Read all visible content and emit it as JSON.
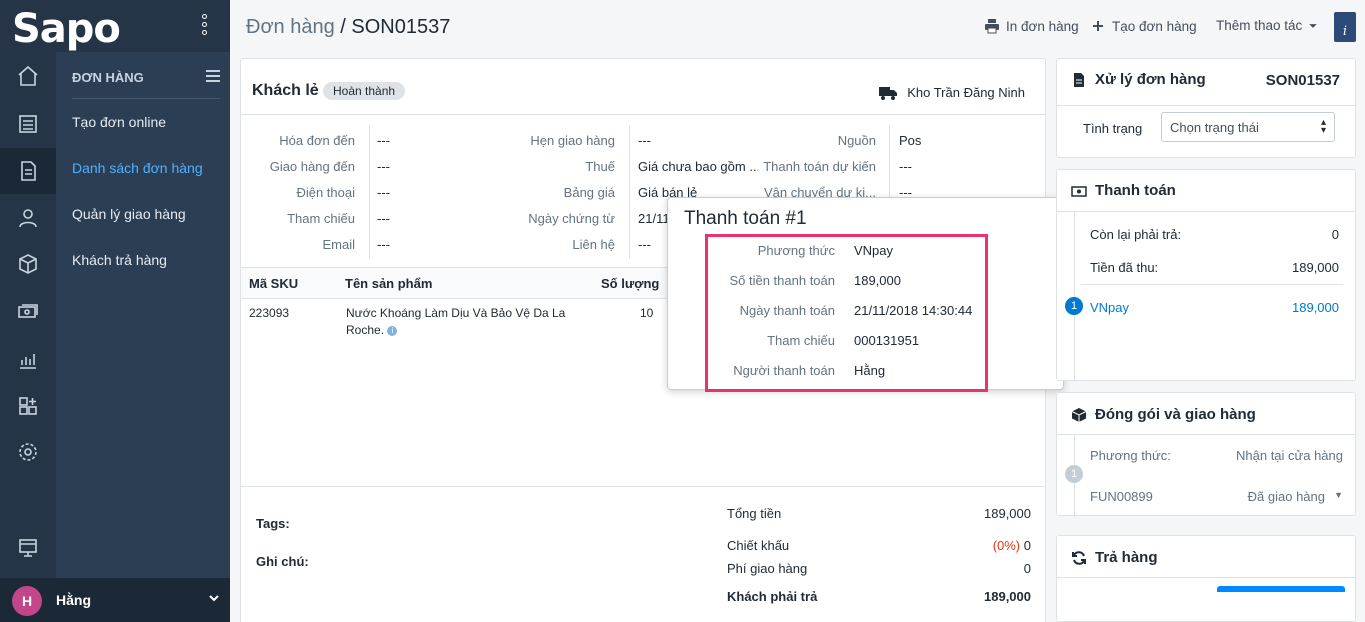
{
  "app": {
    "logo": "Sapo"
  },
  "sidebar": {
    "section_title": "ĐƠN HÀNG",
    "items": [
      {
        "label": "Tạo đơn online"
      },
      {
        "label": "Danh sách đơn hàng"
      },
      {
        "label": "Quản lý giao hàng"
      },
      {
        "label": "Khách trả hàng"
      }
    ],
    "user": {
      "initial": "H",
      "name": "Hằng"
    }
  },
  "header": {
    "breadcrumb": "Đơn hàng",
    "separator": " / ",
    "order_code": "SON01537",
    "print_label": "In đơn hàng",
    "create_label": "Tạo đơn hàng",
    "more_label": "Thêm thao tác",
    "help_glyph": "i"
  },
  "order": {
    "customer": "Khách lẻ",
    "status": "Hoàn thành",
    "warehouse": "Kho Trần Đăng Ninh",
    "info_col1": [
      {
        "label": "Hóa đơn đến",
        "value": "---"
      },
      {
        "label": "Giao hàng đến",
        "value": "---"
      },
      {
        "label": "Điện thoại",
        "value": "---"
      },
      {
        "label": "Tham chiếu",
        "value": "---"
      },
      {
        "label": "Email",
        "value": "---"
      }
    ],
    "info_col2": [
      {
        "label": "Hẹn giao hàng",
        "value": "---"
      },
      {
        "label": "Thuế",
        "value": "Giá chưa bao gồm ..."
      },
      {
        "label": "Bảng giá",
        "value": "Giá bán lẻ"
      },
      {
        "label": "Ngày chứng từ",
        "value": "21/11"
      },
      {
        "label": "Liên hệ",
        "value": "---"
      }
    ],
    "info_col3": [
      {
        "label": "Nguồn",
        "value": "Pos"
      },
      {
        "label": "Thanh toán dự kiến",
        "value": "---"
      },
      {
        "label": "Vận chuyển dự ki...",
        "value": "---"
      }
    ],
    "table": {
      "headers": {
        "sku": "Mã SKU",
        "name": "Tên sản phẩm",
        "qty": "Số lượng"
      },
      "rows": [
        {
          "sku": "223093",
          "name_line1": "Nước Khoáng Làm Dịu Và Bảo Vệ Da La",
          "name_line2": "Roche.",
          "qty": "10"
        }
      ]
    },
    "footer": {
      "tags_label": "Tags:",
      "note_label": "Ghi chú:",
      "total_label": "Tổng tiền",
      "total_value": "189,000",
      "discount_label": "Chiết khấu",
      "discount_pct": "(0%)",
      "discount_value": "0",
      "shipping_label": "Phí giao hàng",
      "shipping_value": "0",
      "payable_label": "Khách phải trả",
      "payable_value": "189,000"
    }
  },
  "payment_popover": {
    "title": "Thanh toán #1",
    "rows": [
      {
        "label": "Phương thức",
        "value": "VNpay"
      },
      {
        "label": "Số tiền thanh toán",
        "value": "189,000"
      },
      {
        "label": "Ngày thanh toán",
        "value": "21/11/2018 14:30:44"
      },
      {
        "label": "Tham chiếu",
        "value": "000131951"
      },
      {
        "label": "Người thanh toán",
        "value": "Hằng"
      }
    ]
  },
  "process_card": {
    "title": "Xử lý đơn hàng",
    "code": "SON01537",
    "status_label": "Tình trạng",
    "status_placeholder": "Chọn trạng thái"
  },
  "payment_card": {
    "title": "Thanh toán",
    "remaining_label": "Còn lại phải trả:",
    "remaining_value": "0",
    "paid_label": "Tiền đã thu:",
    "paid_value": "189,000",
    "step": "1",
    "method": "VNpay",
    "method_value": "189,000"
  },
  "shipping_card": {
    "title": "Đóng gói và giao hàng",
    "step": "1",
    "method_label": "Phương thức:",
    "method_value": "Nhận tại cửa hàng",
    "code": "FUN00899",
    "status": "Đã giao hàng"
  },
  "return_card": {
    "title": "Trả hàng"
  },
  "colors": {
    "accent": "#007ace",
    "highlight_border": "#e8336e",
    "sidebar": "#253547"
  }
}
